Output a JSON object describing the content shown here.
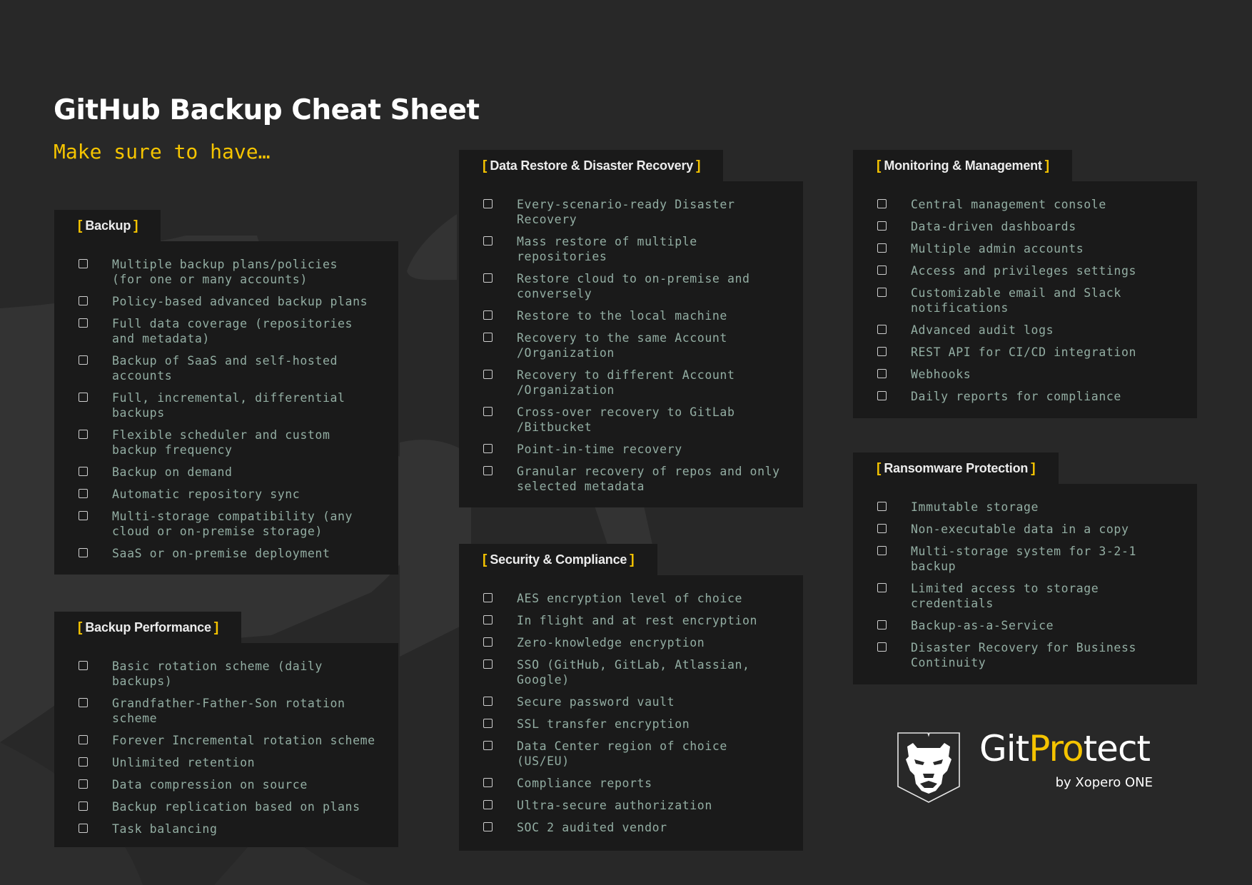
{
  "title": "GitHub Backup Cheat Sheet",
  "subtitle": "Make sure to have…",
  "colors": {
    "background": "#282828",
    "card": "#1a1a1a",
    "accent": "#f5c400",
    "item_text": "#93aea3",
    "heading_text": "#ececec"
  },
  "sections": [
    {
      "id": "backup",
      "heading": "Backup",
      "items": [
        "Multiple backup plans/policies\n(for one or many accounts)",
        "Policy-based advanced backup plans",
        "Full data coverage (repositories\nand metadata)",
        "Backup of SaaS and self-hosted\naccounts",
        "Full, incremental, differential\nbackups",
        "Flexible scheduler and custom\nbackup frequency",
        "Backup on demand",
        "Automatic repository sync",
        "Multi-storage compatibility (any\ncloud or on-premise storage)",
        "SaaS or on-premise deployment"
      ]
    },
    {
      "id": "backup-performance",
      "heading": "Backup Performance",
      "items": [
        "Basic rotation scheme (daily\nbackups)",
        "Grandfather-Father-Son rotation\nscheme",
        "Forever Incremental rotation scheme",
        "Unlimited retention",
        "Data compression on source",
        "Backup replication based on plans",
        "Task balancing"
      ]
    },
    {
      "id": "data-restore",
      "heading": "Data Restore & Disaster Recovery",
      "items": [
        "Every-scenario-ready Disaster\nRecovery",
        "Mass restore of multiple\nrepositories",
        "Restore cloud to on-premise and\nconversely",
        "Restore to the local machine",
        "Recovery to the same Account\n/Organization",
        "Recovery to different Account\n/Organization",
        "Cross-over recovery to GitLab\n/Bitbucket",
        "Point-in-time recovery",
        "Granular recovery of repos and only\nselected metadata"
      ]
    },
    {
      "id": "security-compliance",
      "heading": "Security & Compliance",
      "items": [
        "AES encryption level of choice",
        "In flight and at rest encryption",
        "Zero-knowledge encryption",
        "SSO (GitHub, GitLab, Atlassian,\nGoogle)",
        "Secure password vault",
        "SSL transfer encryption",
        "Data Center region of choice\n(US/EU)",
        "Compliance reports",
        "Ultra-secure authorization",
        "SOC 2 audited vendor"
      ]
    },
    {
      "id": "monitoring-management",
      "heading": "Monitoring & Management",
      "items": [
        "Central management console",
        "Data-driven dashboards",
        "Multiple admin accounts",
        "Access and privileges settings",
        "Customizable email and Slack\nnotifications",
        "Advanced audit logs",
        "REST API for CI/CD integration",
        "Webhooks",
        "Daily reports for compliance"
      ]
    },
    {
      "id": "ransomware-protection",
      "heading": "Ransomware Protection",
      "items": [
        "Immutable storage",
        "Non-executable data in a copy",
        "Multi-storage system for 3-2-1\nbackup",
        "Limited access to storage\ncredentials",
        "Backup-as-a-Service",
        "Disaster Recovery for Business\nContinuity"
      ]
    }
  ],
  "bracket_open": "[",
  "bracket_close": "]",
  "logo": {
    "name_part1": "Git",
    "name_part2": "Pro",
    "name_part3": "tect",
    "byline": "by Xopero ONE",
    "icon": "lion-shield-icon"
  }
}
